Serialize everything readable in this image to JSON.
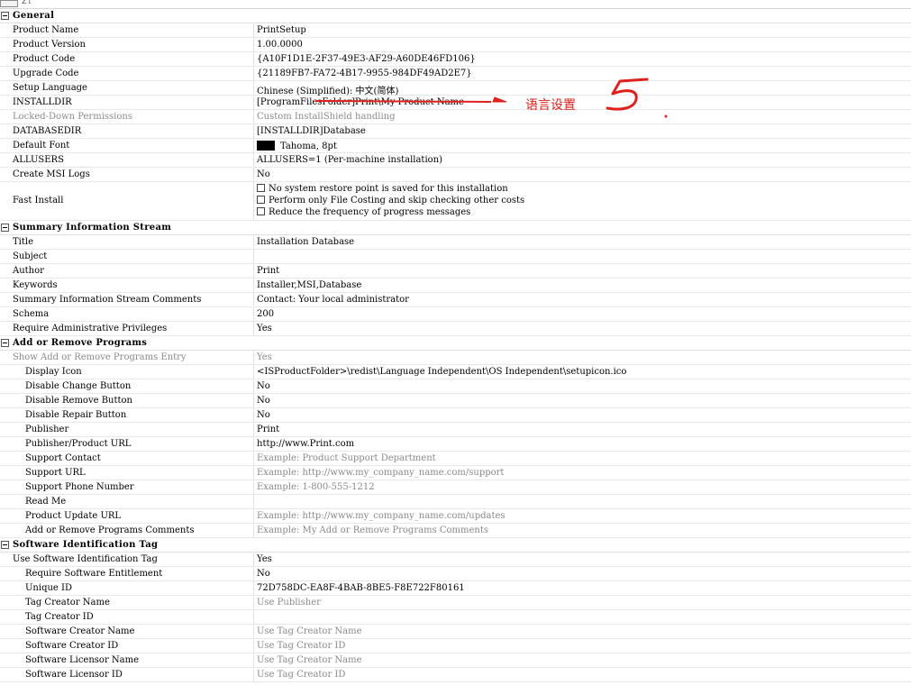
{
  "toolbar": {
    "glyph": "Z↓"
  },
  "sections": {
    "general": {
      "title": "General",
      "rows": [
        {
          "name": "Product Name",
          "value": "PrintSetup"
        },
        {
          "name": "Product Version",
          "value": "1.00.0000"
        },
        {
          "name": "Product Code",
          "value": "{A10F1D1E-2F37-49E3-AF29-A60DE46FD106}"
        },
        {
          "name": "Upgrade Code",
          "value": "{21189FB7-FA72-4B17-9955-984DF49AD2E7}"
        },
        {
          "name": "Setup Language",
          "value": "Chinese (Simplified): 中文(简体)"
        },
        {
          "name": "INSTALLDIR",
          "value": "[ProgramFilesFolder]Print\\My Product Name"
        },
        {
          "name": "Locked-Down Permissions",
          "value": "Custom InstallShield handling"
        },
        {
          "name": "DATABASEDIR",
          "value": "[INSTALLDIR]Database"
        },
        {
          "name": "Default Font",
          "value": "Tahoma, 8pt"
        },
        {
          "name": "ALLUSERS",
          "value": "ALLUSERS=1 (Per-machine installation)"
        },
        {
          "name": "Create MSI Logs",
          "value": "No"
        },
        {
          "name": "Fast Install",
          "options": [
            "No system restore point is saved for this installation",
            "Perform only File Costing and skip checking other costs",
            "Reduce the frequency of progress messages"
          ]
        }
      ]
    },
    "summary": {
      "title": "Summary Information Stream",
      "rows": [
        {
          "name": "Title",
          "value": "Installation Database"
        },
        {
          "name": "Subject",
          "value": ""
        },
        {
          "name": "Author",
          "value": "Print"
        },
        {
          "name": "Keywords",
          "value": "Installer,MSI,Database"
        },
        {
          "name": "Summary Information Stream Comments",
          "value": "Contact:  Your local administrator"
        },
        {
          "name": "Schema",
          "value": "200"
        },
        {
          "name": "Require Administrative Privileges",
          "value": "Yes"
        }
      ]
    },
    "arp": {
      "title": "Add or Remove Programs",
      "rows": [
        {
          "name": "Show Add or Remove Programs Entry",
          "value": "Yes"
        },
        {
          "name": "Display Icon",
          "value": "<ISProductFolder>\\redist\\Language Independent\\OS Independent\\setupicon.ico"
        },
        {
          "name": "Disable Change Button",
          "value": "No"
        },
        {
          "name": "Disable Remove Button",
          "value": "No"
        },
        {
          "name": "Disable Repair Button",
          "value": "No"
        },
        {
          "name": "Publisher",
          "value": "Print"
        },
        {
          "name": "Publisher/Product URL",
          "value": "http://www.Print.com"
        },
        {
          "name": "Support Contact",
          "value": "Example: Product Support Department"
        },
        {
          "name": "Support URL",
          "value": "Example: http://www.my_company_name.com/support"
        },
        {
          "name": "Support Phone Number",
          "value": "Example: 1-800-555-1212"
        },
        {
          "name": "Read Me",
          "value": ""
        },
        {
          "name": "Product Update URL",
          "value": "Example: http://www.my_company_name.com/updates"
        },
        {
          "name": "Add or Remove Programs Comments",
          "value": "Example: My Add or Remove Programs Comments"
        }
      ]
    },
    "swid": {
      "title": "Software Identification Tag",
      "rows": [
        {
          "name": "Use Software Identification Tag",
          "value": "Yes"
        },
        {
          "name": "Require Software Entitlement",
          "value": "No"
        },
        {
          "name": "Unique ID",
          "value": "72D758DC-EA8F-4BAB-8BE5-F8E722F80161"
        },
        {
          "name": "Tag Creator Name",
          "value": "Use Publisher"
        },
        {
          "name": "Tag Creator ID",
          "value": ""
        },
        {
          "name": "Software Creator Name",
          "value": "Use Tag Creator Name"
        },
        {
          "name": "Software Creator ID",
          "value": "Use Tag Creator ID"
        },
        {
          "name": "Software Licensor Name",
          "value": "Use Tag Creator Name"
        },
        {
          "name": "Software Licensor ID",
          "value": "Use Tag Creator ID"
        }
      ]
    }
  },
  "annotation": {
    "text": "语言设置",
    "number": "5",
    "color": "#e0201a"
  }
}
